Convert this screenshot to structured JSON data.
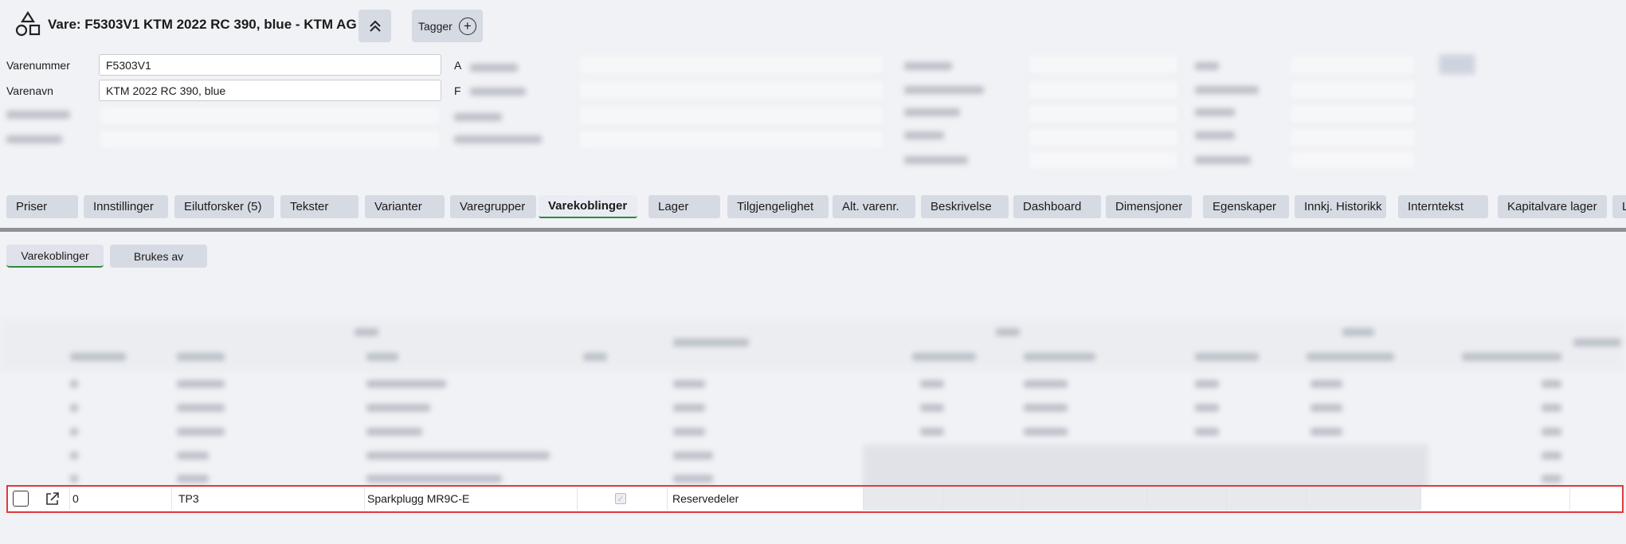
{
  "header": {
    "title": "Vare: F5303V1 KTM 2022 RC 390, blue - KTM AG",
    "tags_label": "Tagger",
    "app_icon": "shapes-icon",
    "collapse_icon": "chevron-double-up-icon",
    "add_tag_icon": "plus-circle-icon"
  },
  "form": {
    "varenummer_label": "Varenummer",
    "varenummer_value": "F5303V1",
    "varenavn_label": "Varenavn",
    "varenavn_value": "KTM 2022 RC 390, blue",
    "right_label_1": "A",
    "right_label_2": "F"
  },
  "tabs": [
    {
      "label": "Priser",
      "active": false
    },
    {
      "label": "Innstillinger",
      "active": false
    },
    {
      "label": "Eilutforsker (5)",
      "active": false
    },
    {
      "label": "Tekster",
      "active": false
    },
    {
      "label": "Varianter",
      "active": false
    },
    {
      "label": "Varegrupper",
      "active": false
    },
    {
      "label": "Varekoblinger",
      "active": true
    },
    {
      "label": "Lager",
      "active": false
    },
    {
      "label": "Tilgjengelighet",
      "active": false
    },
    {
      "label": "Alt. varenr.",
      "active": false
    },
    {
      "label": "Beskrivelse",
      "active": false
    },
    {
      "label": "Dashboard",
      "active": false
    },
    {
      "label": "Dimensjoner",
      "active": false
    },
    {
      "label": "Egenskaper",
      "active": false
    },
    {
      "label": "Innkj. Historikk",
      "active": false
    },
    {
      "label": "Interntekst",
      "active": false
    },
    {
      "label": "Kapitalvare lager",
      "active": false
    },
    {
      "label": "L",
      "active": false
    }
  ],
  "subtabs": [
    {
      "label": "Varekoblinger",
      "active": true
    },
    {
      "label": "Brukes av",
      "active": false
    }
  ],
  "highlighted_row": {
    "sortering": "0",
    "varenummer": "TP3",
    "varenavn": "Sparkplugg MR9C-E",
    "koblingstype": "Reservedeler",
    "checkbox_icon": "checkbox-icon",
    "open_icon": "external-link-icon",
    "checked_icon": "checkmark-icon"
  },
  "colors": {
    "highlight_border": "#e03a3a",
    "active_tab_underline": "#2e8b3e",
    "tab_bg": "#d6dae3"
  }
}
